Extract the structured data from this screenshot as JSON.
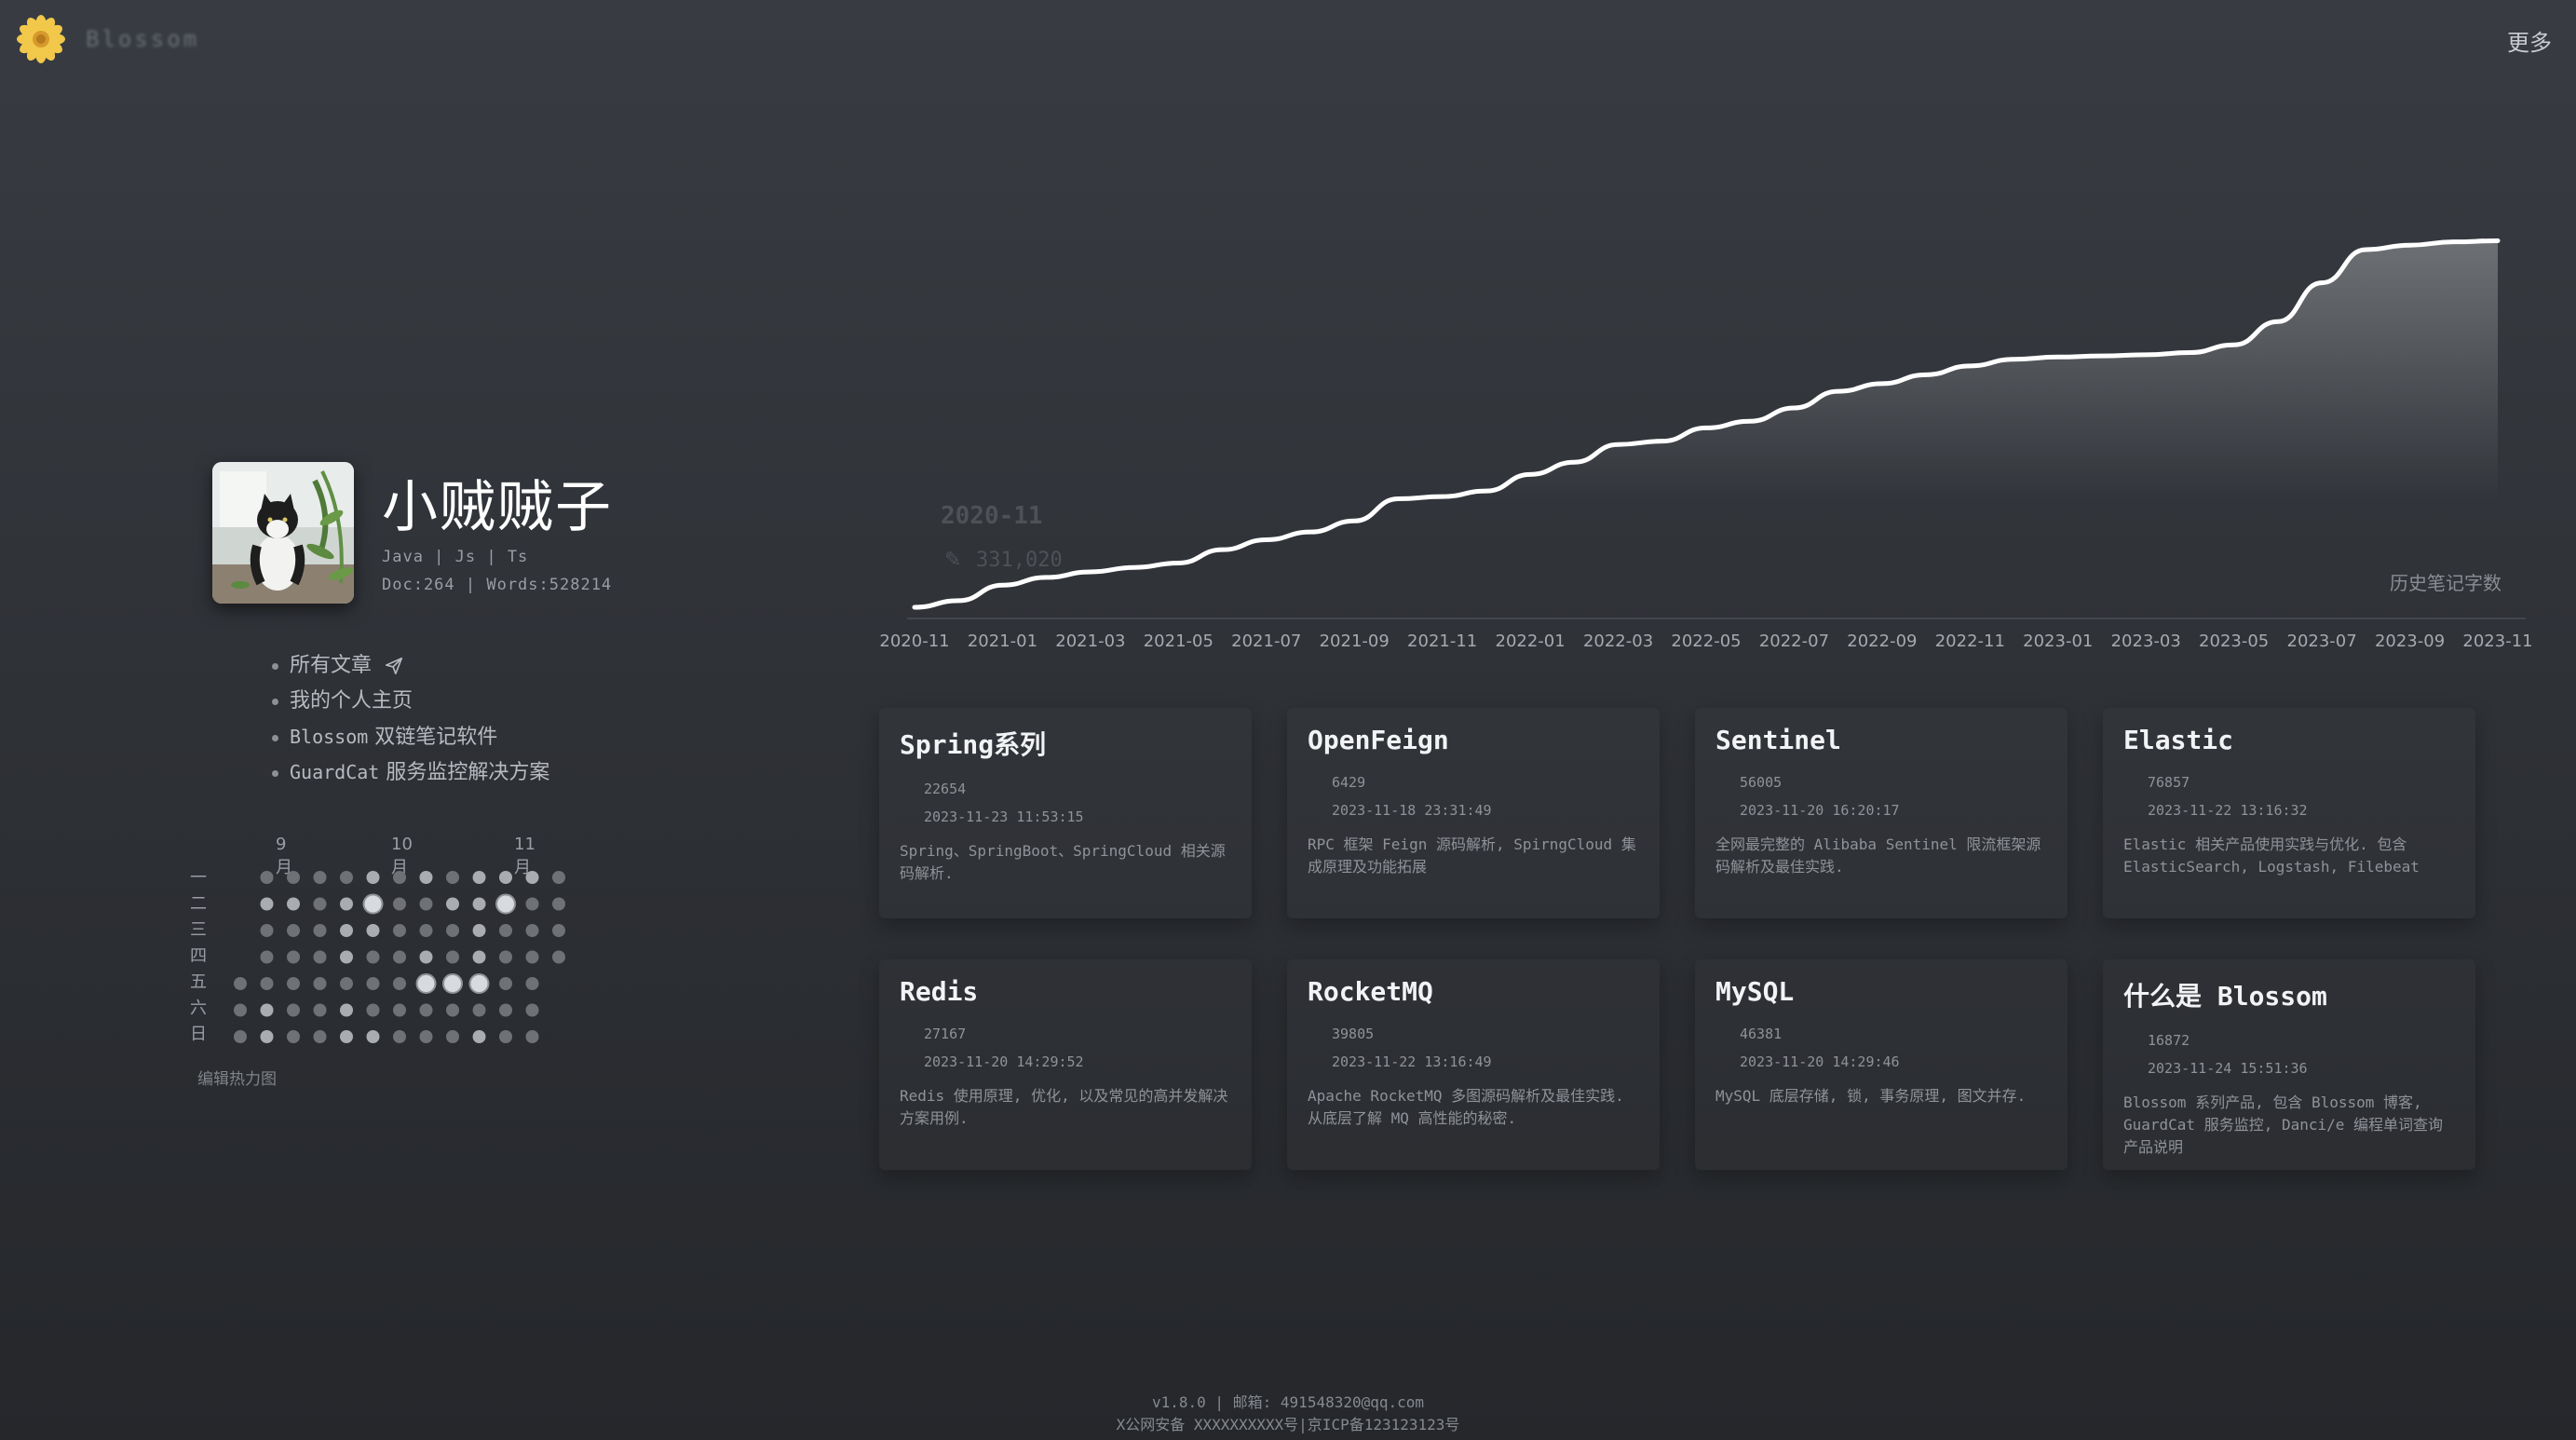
{
  "header": {
    "brand": "Blossom",
    "more_label": "更多",
    "colors": {
      "logo": "#f2c84b",
      "logo_center": "#d69a2c"
    }
  },
  "profile": {
    "name": "小贼贼子",
    "tags": "Java | Js | Ts",
    "stats": "Doc:264 | Words:528214",
    "avatar_icon": "cat-photo-avatar"
  },
  "links": [
    {
      "label": "所有文章",
      "icon": "paper-plane-icon"
    },
    {
      "label": "我的个人主页"
    },
    {
      "label_mono": "Blossom",
      "label": " 双链笔记软件"
    },
    {
      "label_mono": "GuardCat",
      "label": " 服务监控解决方案"
    }
  ],
  "heatmap": {
    "months": [
      "9月",
      "10月",
      "11月"
    ],
    "weekdays": [
      "一",
      "二",
      "三",
      "四",
      "五",
      "六",
      "日"
    ],
    "caption": "编辑热力图",
    "levels": [
      [
        -1,
        1,
        1,
        1,
        1,
        2,
        1,
        2,
        1,
        2,
        2,
        2,
        1,
        -1
      ],
      [
        -1,
        2,
        2,
        1,
        2,
        3,
        1,
        1,
        2,
        2,
        3,
        1,
        1,
        -1
      ],
      [
        -1,
        1,
        1,
        1,
        2,
        2,
        1,
        1,
        1,
        2,
        1,
        1,
        1,
        -1
      ],
      [
        -1,
        1,
        1,
        1,
        2,
        1,
        1,
        2,
        1,
        2,
        1,
        1,
        1,
        -1
      ],
      [
        1,
        1,
        1,
        1,
        1,
        1,
        1,
        3,
        3,
        3,
        1,
        1,
        -1,
        -1
      ],
      [
        1,
        2,
        1,
        1,
        2,
        1,
        1,
        1,
        1,
        1,
        1,
        1,
        -1,
        -1
      ],
      [
        1,
        2,
        1,
        1,
        2,
        2,
        1,
        1,
        1,
        2,
        1,
        1,
        -1,
        -1
      ]
    ],
    "colors": {
      "l1": "#6e7277",
      "l2": "#a9adb2",
      "l3": "#d7dade",
      "empty": "#3a3d42"
    }
  },
  "chart_data": {
    "type": "area",
    "title": "历史笔记字数",
    "x": [
      "2020-11",
      "2020-12",
      "2021-01",
      "2021-02",
      "2021-03",
      "2021-04",
      "2021-05",
      "2021-06",
      "2021-07",
      "2021-08",
      "2021-09",
      "2021-10",
      "2021-11",
      "2021-12",
      "2022-01",
      "2022-02",
      "2022-03",
      "2022-04",
      "2022-05",
      "2022-06",
      "2022-07",
      "2022-08",
      "2022-09",
      "2022-10",
      "2022-11",
      "2022-12",
      "2023-01",
      "2023-02",
      "2023-03",
      "2023-04",
      "2023-05",
      "2023-06",
      "2023-07",
      "2023-08",
      "2023-09",
      "2023-10",
      "2023-11"
    ],
    "x_ticks": [
      "2020-11",
      "2021-01",
      "2021-03",
      "2021-05",
      "2021-07",
      "2021-09",
      "2021-11",
      "2022-01",
      "2022-03",
      "2022-05",
      "2022-07",
      "2022-09",
      "2022-11",
      "2023-01",
      "2023-03",
      "2023-05",
      "2023-07",
      "2023-09",
      "2023-11"
    ],
    "series": [
      {
        "values": [
          0,
          6000,
          20000,
          27000,
          32000,
          36000,
          40000,
          52000,
          61000,
          68000,
          78000,
          98000,
          100000,
          105000,
          120000,
          131000,
          147000,
          150000,
          162000,
          168000,
          180000,
          195000,
          202000,
          210000,
          218000,
          224000,
          226000,
          227000,
          228000,
          230000,
          237000,
          258000,
          293000,
          323000,
          327000,
          330000,
          331000
        ]
      }
    ],
    "tooltip": {
      "date": "2020-11",
      "value": "331,020"
    },
    "ylim": [
      0,
      360000
    ],
    "grid": false,
    "colors": {
      "line": "#ffffff"
    }
  },
  "cards": [
    {
      "title": "Spring系列",
      "count": "22654",
      "time": "2023-11-23 11:53:15",
      "desc": "Spring、SpringBoot、SpringCloud 相关源码解析."
    },
    {
      "title": "OpenFeign",
      "count": "6429",
      "time": "2023-11-18 23:31:49",
      "desc": "RPC 框架 Feign 源码解析, SpirngCloud 集成原理及功能拓展"
    },
    {
      "title": "Sentinel",
      "count": "56005",
      "time": "2023-11-20 16:20:17",
      "desc": "全网最完整的 Alibaba Sentinel 限流框架源码解析及最佳实践."
    },
    {
      "title": "Elastic",
      "count": "76857",
      "time": "2023-11-22 13:16:32",
      "desc": "Elastic 相关产品使用实践与优化. 包含 ElasticSearch, Logstash, Filebeat"
    },
    {
      "title": "Redis",
      "count": "27167",
      "time": "2023-11-20 14:29:52",
      "desc": "Redis 使用原理, 优化, 以及常见的高并发解决方案用例."
    },
    {
      "title": "RocketMQ",
      "count": "39805",
      "time": "2023-11-22 13:16:49",
      "desc": "Apache RocketMQ 多图源码解析及最佳实践. 从底层了解 MQ 高性能的秘密."
    },
    {
      "title": "MySQL",
      "count": "46381",
      "time": "2023-11-20 14:29:46",
      "desc": "MySQL 底层存储, 锁, 事务原理, 图文并存."
    },
    {
      "title": "什么是 Blossom",
      "count": "16872",
      "time": "2023-11-24 15:51:36",
      "desc": "Blossom 系列产品, 包含 Blossom 博客, GuardCat 服务监控, Danci/e 编程单词查询产品说明"
    }
  ],
  "footer": {
    "line1": "v1.8.0 | 邮箱: 491548320@qq.com",
    "line2": "X公网安备 XXXXXXXXXX号|京ICP备123123123号"
  }
}
